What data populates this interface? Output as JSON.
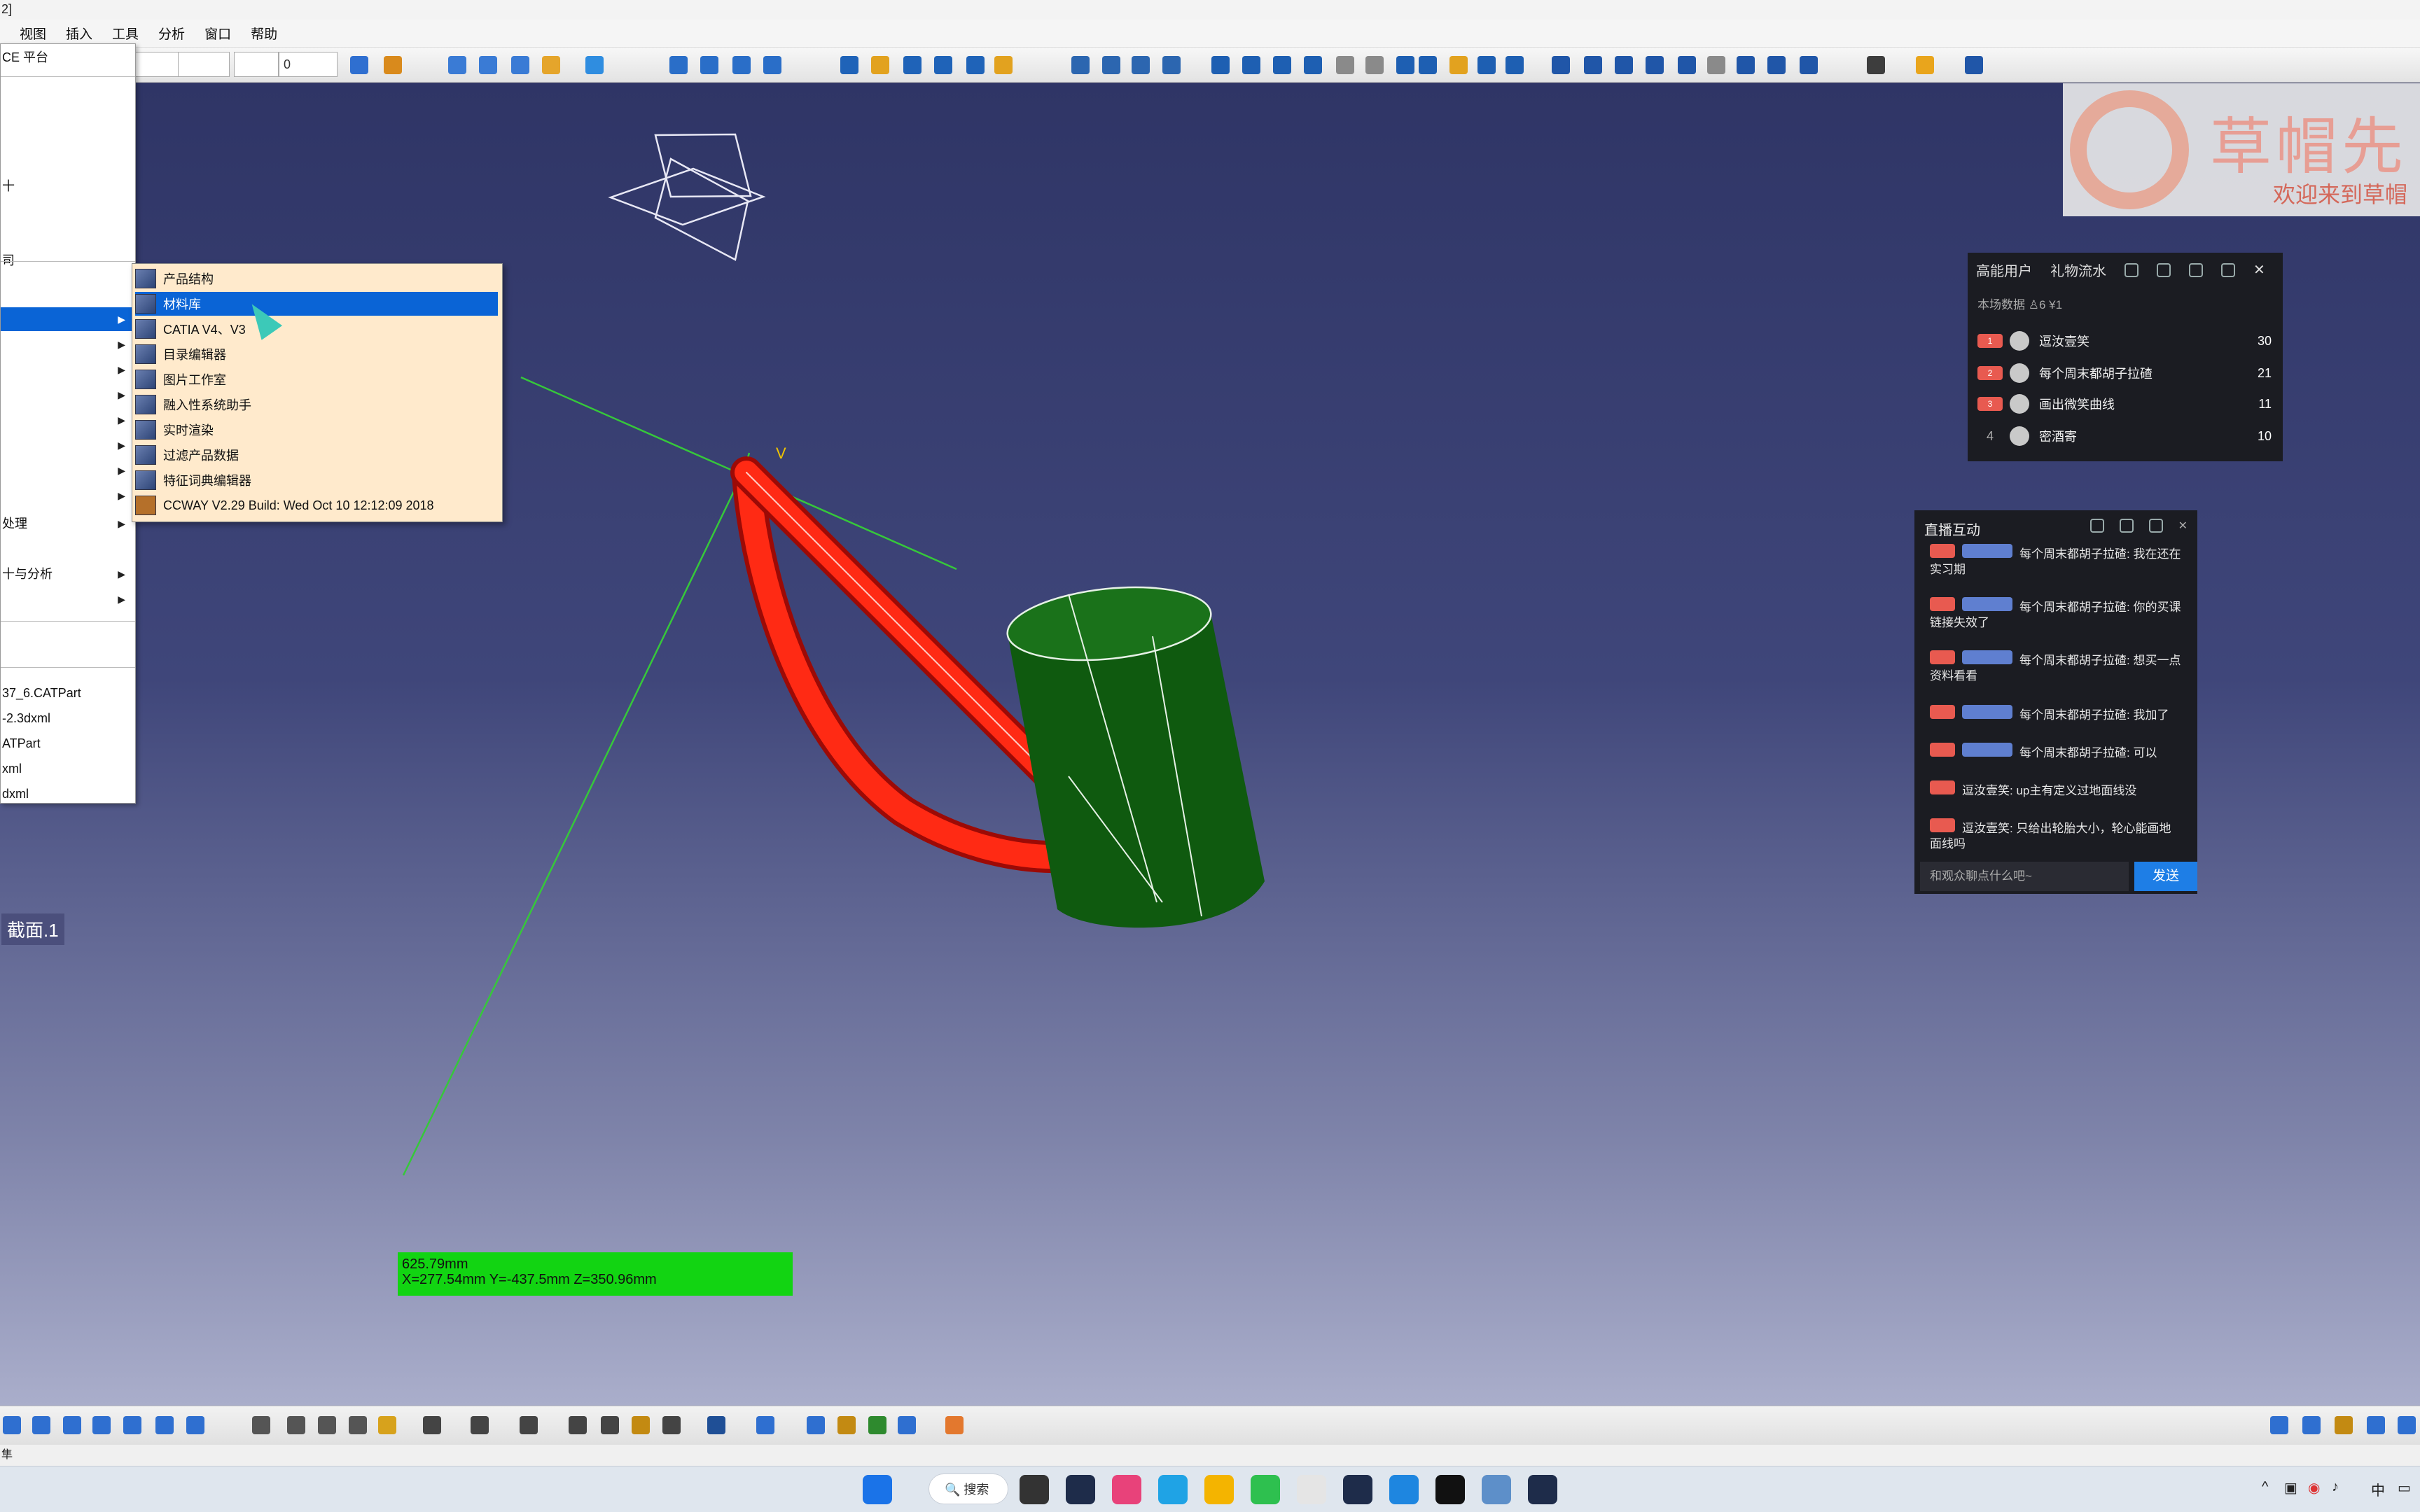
{
  "titlebar": {
    "text": "2]"
  },
  "menubar": {
    "items": [
      "视图",
      "插入",
      "工具",
      "分析",
      "窗口",
      "帮助"
    ]
  },
  "toolbar": {
    "combo1": "",
    "combo2": "",
    "combo3": "0"
  },
  "start_menu": {
    "items": [
      {
        "label": "CE 平台",
        "arrow": false
      },
      {
        "label": "",
        "arrow": false
      },
      {
        "label": "十",
        "arrow": false
      },
      {
        "label": "司",
        "arrow": false
      },
      {
        "label": "",
        "arrow": true,
        "selected": true
      },
      {
        "label": "",
        "arrow": true
      },
      {
        "label": "",
        "arrow": true
      },
      {
        "label": "",
        "arrow": true
      },
      {
        "label": "",
        "arrow": true
      },
      {
        "label": "处理",
        "arrow": true
      },
      {
        "label": "十与分析",
        "arrow": true
      },
      {
        "label": "",
        "arrow": true
      }
    ],
    "recent": [
      "37_6.CATPart",
      "-2.3dxml",
      "ATPart",
      "xml",
      "dxml"
    ]
  },
  "submenu": {
    "items": [
      {
        "label": "产品结构"
      },
      {
        "label": "材料库",
        "selected": true
      },
      {
        "label": "CATIA V4、V3"
      },
      {
        "label": "目录编辑器"
      },
      {
        "label": "图片工作室"
      },
      {
        "label": "融入性系统助手"
      },
      {
        "label": "实时渲染"
      },
      {
        "label": "过滤产品数据"
      },
      {
        "label": "特征词典编辑器"
      },
      {
        "label": "CCWAY V2.29 Build: Wed Oct 10 12:12:09 2018"
      }
    ]
  },
  "section_label": "截面.1",
  "measurement": {
    "line1": "625.79mm",
    "line2": "X=277.54mm  Y=-437.5mm  Z=350.96mm"
  },
  "logo": {
    "brand": "草帽先",
    "welcome": "欢迎来到草帽"
  },
  "ranking_panel": {
    "tab1": "高能用户",
    "tab2": "礼物流水",
    "stats": "本场数据   ♙6   ¥1",
    "rows": [
      {
        "rank": "1",
        "name": "逗汝壹笑",
        "value": "30"
      },
      {
        "rank": "2",
        "name": "每个周末都胡子拉碴",
        "value": "21"
      },
      {
        "rank": "3",
        "name": "画出微笑曲线",
        "value": "11"
      },
      {
        "rank": "4",
        "name": "密酒寄",
        "value": "10"
      }
    ]
  },
  "chat_panel": {
    "title": "直播互动",
    "messages": [
      "每个周末都胡子拉碴: 我在还在实习期",
      "每个周末都胡子拉碴: 你的买课链接失效了",
      "每个周末都胡子拉碴: 想买一点资料看看",
      "每个周末都胡子拉碴: 我加了",
      "每个周末都胡子拉碴: 可以",
      "逗汝壹笑: up主有定义过地面线没",
      "逗汝壹笑: 只给出轮胎大小，轮心能画地面线吗"
    ],
    "input_placeholder": "和观众聊点什么吧~",
    "send_label": "发送"
  },
  "statusbar": {
    "text": "隼"
  },
  "taskbar": {
    "search": "搜索",
    "ime": "中"
  },
  "colors": {
    "accent": "#0a64d6",
    "tube": "#ff1a0f",
    "cylinder": "#0f5a0f",
    "measure_bg": "#12d412"
  }
}
